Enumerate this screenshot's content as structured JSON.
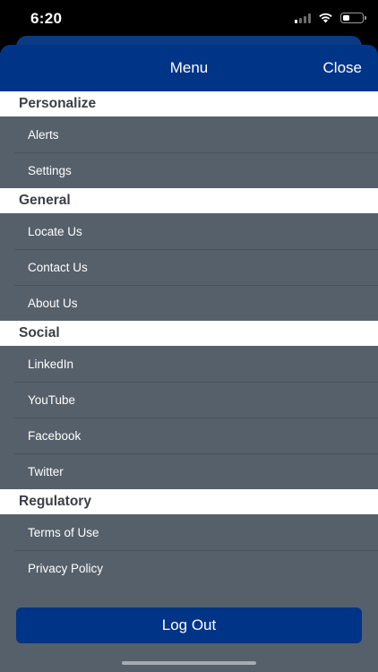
{
  "status_bar": {
    "time": "6:20",
    "signal_strength": 1,
    "battery_level": 0.35,
    "icons": [
      "cellular-signal-icon",
      "wifi-icon",
      "battery-icon"
    ]
  },
  "header": {
    "title": "Menu",
    "close_label": "Close"
  },
  "sections": [
    {
      "title": "Personalize",
      "items": [
        "Alerts",
        "Settings"
      ]
    },
    {
      "title": "General",
      "items": [
        "Locate Us",
        "Contact Us",
        "About Us"
      ]
    },
    {
      "title": "Social",
      "items": [
        "LinkedIn",
        "YouTube",
        "Facebook",
        "Twitter"
      ]
    },
    {
      "title": "Regulatory",
      "items": [
        "Terms of Use",
        "Privacy Policy"
      ]
    }
  ],
  "logout_label": "Log Out",
  "colors": {
    "header_blue": "#003487",
    "menu_background": "#56606a",
    "section_background": "#ffffff",
    "section_text": "#3b3f45"
  }
}
